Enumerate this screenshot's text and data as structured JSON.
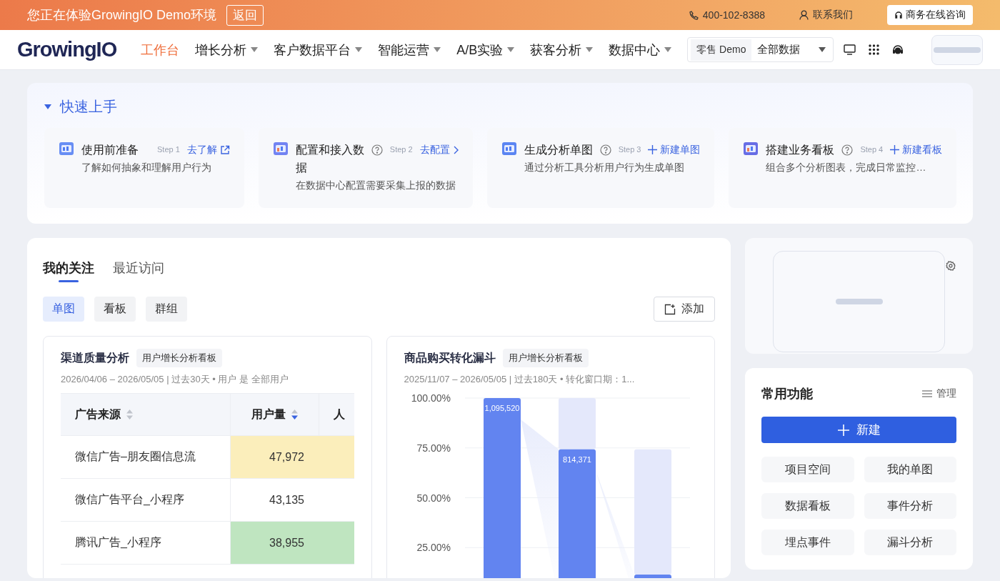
{
  "banner": {
    "message": "您正在体验GrowingIO Demo环境",
    "back_button": "返回",
    "phone": "400-102-8388",
    "contact": "联系我们",
    "consult_button": "商务在线咨询"
  },
  "nav": {
    "logo": "GrowingIO",
    "items": [
      {
        "label": "工作台",
        "selected": true,
        "dropdown": false
      },
      {
        "label": "增长分析",
        "selected": false,
        "dropdown": true
      },
      {
        "label": "客户数据平台",
        "selected": false,
        "dropdown": true
      },
      {
        "label": "智能运营",
        "selected": false,
        "dropdown": true
      },
      {
        "label": "A/B实验",
        "selected": false,
        "dropdown": true
      },
      {
        "label": "获客分析",
        "selected": false,
        "dropdown": true
      },
      {
        "label": "数据中心",
        "selected": false,
        "dropdown": true
      }
    ],
    "project": "零售 Demo",
    "data_scope": "全部数据"
  },
  "quick_start": {
    "title": "快速上手",
    "expanded": true,
    "steps": [
      {
        "kind": "external",
        "title": "使用前准备",
        "help": false,
        "step": "Step 1",
        "action": "去了解",
        "description": "了解如何抽象和理解用户行为"
      },
      {
        "kind": "chevron",
        "title": "配置和接入数据",
        "help": true,
        "step": "Step 2",
        "action": "去配置",
        "description": "在数据中心配置需要采集上报的数据"
      },
      {
        "kind": "plus",
        "title": "生成分析单图",
        "help": true,
        "step": "Step 3",
        "action": "新建单图",
        "description": "通过分析工具分析用户行为生成单图"
      },
      {
        "kind": "plus",
        "title": "搭建业务看板",
        "help": true,
        "step": "Step 4",
        "action": "新建看板",
        "description": "组合多个分析图表，完成日常监控…"
      }
    ]
  },
  "favorites": {
    "tabs": [
      {
        "label": "我的关注",
        "selected": true
      },
      {
        "label": "最近访问",
        "selected": false
      }
    ],
    "filters": [
      {
        "label": "单图",
        "selected": true
      },
      {
        "label": "看板",
        "selected": false
      },
      {
        "label": "群组",
        "selected": false
      }
    ],
    "add_button": "添加",
    "cards": [
      {
        "kind": "table",
        "title": "渠道质量分析",
        "tag": "用户增长分析看板",
        "meta": "2026/04/06 – 2026/05/05 | 过去30天 • 用户 是 全部用户",
        "columns": [
          {
            "label": "广告来源",
            "sorted": false
          },
          {
            "label": "用户量",
            "sorted": true
          },
          {
            "label": "人"
          }
        ],
        "rows": [
          {
            "source": "微信广告–朋友圈信息流",
            "users": "47,972",
            "color": "#fbeebb"
          },
          {
            "source": "微信广告平台_小程序",
            "users": "43,135",
            "color": "#ffffff"
          },
          {
            "source": "腾讯广告_小程序",
            "users": "38,955",
            "color": "#bfe5c0"
          }
        ]
      },
      {
        "kind": "funnel",
        "title": "商品购买转化漏斗",
        "tag": "用户增长分析看板",
        "meta": "2025/11/07 – 2026/05/05 | 过去180天 • 转化窗口期：1...",
        "chart_data": {
          "type": "bar",
          "grid": true,
          "ylim": [
            0,
            100
          ],
          "yticks": [
            {
              "value": 25,
              "label": "25.00%"
            },
            {
              "value": 50,
              "label": "50.00%"
            },
            {
              "value": 75,
              "label": "75.00%"
            },
            {
              "value": 100,
              "label": "100.00%"
            }
          ],
          "stacked": true,
          "series": [
            {
              "color": "#6284f0",
              "values": [
                100,
                74.3,
                11.5
              ]
            },
            {
              "color": "#e4e8fb",
              "values": [
                0,
                25.7,
                62.8
              ]
            }
          ],
          "value_labels": [
            "1,095,520",
            "814,371",
            null
          ]
        }
      }
    ]
  },
  "functions": {
    "title": "常用功能",
    "manage": "管理",
    "new_button": "新建",
    "items": [
      "项目空间",
      "我的单图",
      "数据看板",
      "事件分析",
      "埋点事件",
      "漏斗分析"
    ]
  }
}
